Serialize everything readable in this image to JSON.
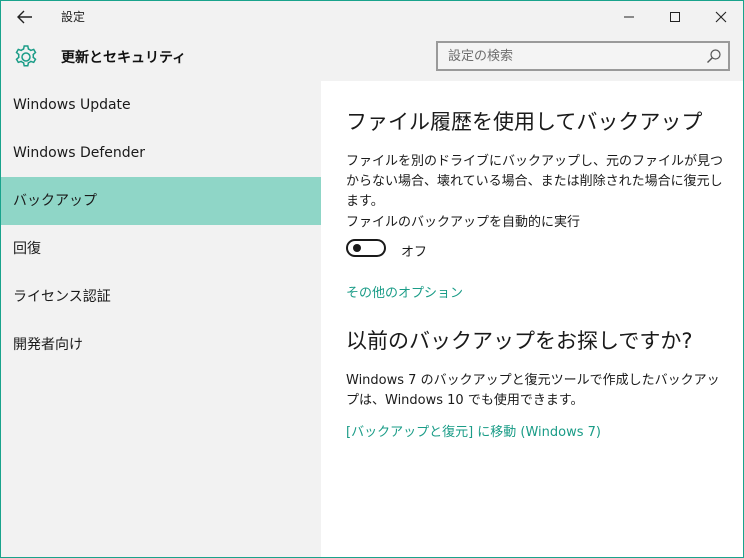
{
  "window": {
    "title": "設定"
  },
  "header": {
    "title": "更新とセキュリティ",
    "search_placeholder": "設定の検索"
  },
  "sidebar": {
    "items": [
      {
        "label": "Windows Update"
      },
      {
        "label": "Windows Defender"
      },
      {
        "label": "バックアップ",
        "selected": true
      },
      {
        "label": "回復"
      },
      {
        "label": "ライセンス認証"
      },
      {
        "label": "開発者向け"
      }
    ]
  },
  "main": {
    "heading": "ファイル履歴を使用してバックアップ",
    "description": "ファイルを別のドライブにバックアップし、元のファイルが見つからない場合、壊れている場合、または削除された場合に復元します。",
    "auto_backup_label": "ファイルのバックアップを自動的に実行",
    "toggle_state": "オフ",
    "toggle_on": false,
    "more_options_link": "その他のオプション",
    "old_backup_heading": "以前のバックアップをお探しですか?",
    "old_backup_description": "Windows 7 のバックアップと復元ツールで作成したバックアップは、Windows 10 でも使用できます。",
    "goto_link": "[バックアップと復元] に移動 (Windows 7)"
  },
  "colors": {
    "accent": "#1a9c87",
    "selected_bg": "#8fd6c7",
    "window_border": "#19a38c",
    "sidebar_bg": "#f2f2f2",
    "content_bg": "#ffffff"
  },
  "icons": {
    "back": "back-arrow-icon",
    "settings": "gear-icon",
    "search": "search-icon",
    "minimize": "minimize-icon",
    "maximize": "maximize-icon",
    "close": "close-icon"
  }
}
